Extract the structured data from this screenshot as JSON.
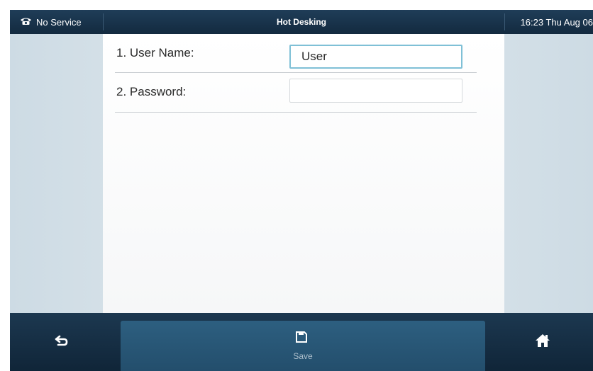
{
  "status_bar": {
    "left_text": "No Service",
    "left_icon": "phone-icon",
    "title": "Hot Desking",
    "datetime": "16:23 Thu Aug 06"
  },
  "form": {
    "rows": [
      {
        "label": "1. User Name:",
        "value": "User",
        "placeholder": ""
      },
      {
        "label": "2. Password:",
        "value": "",
        "placeholder": ""
      }
    ]
  },
  "softkeys": {
    "back_icon": "back-arrow-icon",
    "save_label": "Save",
    "save_icon": "save-icon",
    "home_icon": "home-icon"
  },
  "colors": {
    "status_bar_bg": "#1a344b",
    "softkey_active_bg": "#2a5a7a",
    "focus_border": "#7fc0d6",
    "side_bg": "#d7e3ea"
  }
}
